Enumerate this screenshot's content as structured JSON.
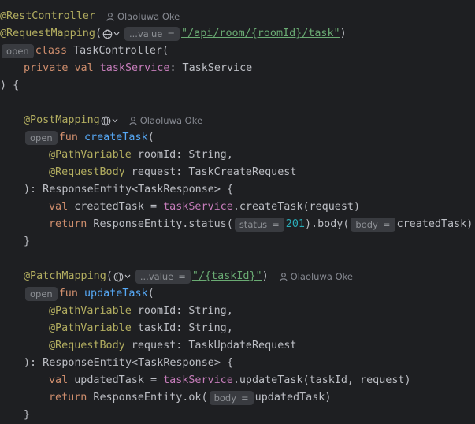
{
  "editor": {
    "author_name": "Olaoluwa Oke",
    "controller": {
      "rest_controller": "@RestController",
      "request_mapping": "@RequestMapping",
      "value_hint": "...value",
      "hint_eq": "=",
      "path": "\"/api/room/{roomId}/task\"",
      "close_paren": ")",
      "open_hint": "open",
      "class_kw": "class",
      "class_name": " TaskController(",
      "private_kw": "private",
      "val_kw": "val",
      "task_service_prop": "taskService",
      "task_service_type": ": TaskService",
      "class_close": ") {"
    },
    "create": {
      "post_mapping": "@PostMapping",
      "open_hint": "open",
      "fun_kw": "fun",
      "name": "createTask",
      "paren": "(",
      "path_variable": "@PathVariable",
      "param1": " roomId: String,",
      "request_body": "@RequestBody",
      "param2": " request: TaskCreateRequest",
      "return_type": "): ResponseEntity<TaskResponse> {",
      "val_kw": "val",
      "var_name": " createdTask = ",
      "service_prop": "taskService",
      "call": ".createTask(request)",
      "return_kw": "return",
      "response_status": " ResponseEntity.status(",
      "status_hint": "status",
      "status_code": "201",
      "body_call": ").body(",
      "body_hint": "body",
      "body_arg": "createdTask)",
      "close": "}"
    },
    "update": {
      "patch_mapping": "@PatchMapping",
      "value_hint": "...value",
      "path": "\"/{taskId}\"",
      "close_paren": ")",
      "open_hint": "open",
      "fun_kw": "fun",
      "name": "updateTask",
      "paren": "(",
      "path_variable": "@PathVariable",
      "param1": " roomId: String,",
      "param2": " taskId: String,",
      "request_body": "@RequestBody",
      "param3": " request: TaskUpdateRequest",
      "return_type": "): ResponseEntity<TaskResponse> {",
      "val_kw": "val",
      "var_name": " updatedTask = ",
      "service_prop": "taskService",
      "call": ".updateTask(taskId, request)",
      "return_kw": "return",
      "response_ok": " ResponseEntity.ok(",
      "body_hint": "body",
      "body_arg": "updatedTask)",
      "close": "}"
    }
  },
  "colors": {
    "background": "#1e1f22",
    "annotation": "#b3ae60",
    "keyword": "#cf8e6d",
    "property": "#c77dbb",
    "function": "#56a8f5",
    "number": "#2aacb8",
    "string": "#6aab73",
    "hint_bg": "#393b40"
  },
  "icons": [
    "person-icon",
    "globe-icon",
    "chevron-down-icon"
  ]
}
